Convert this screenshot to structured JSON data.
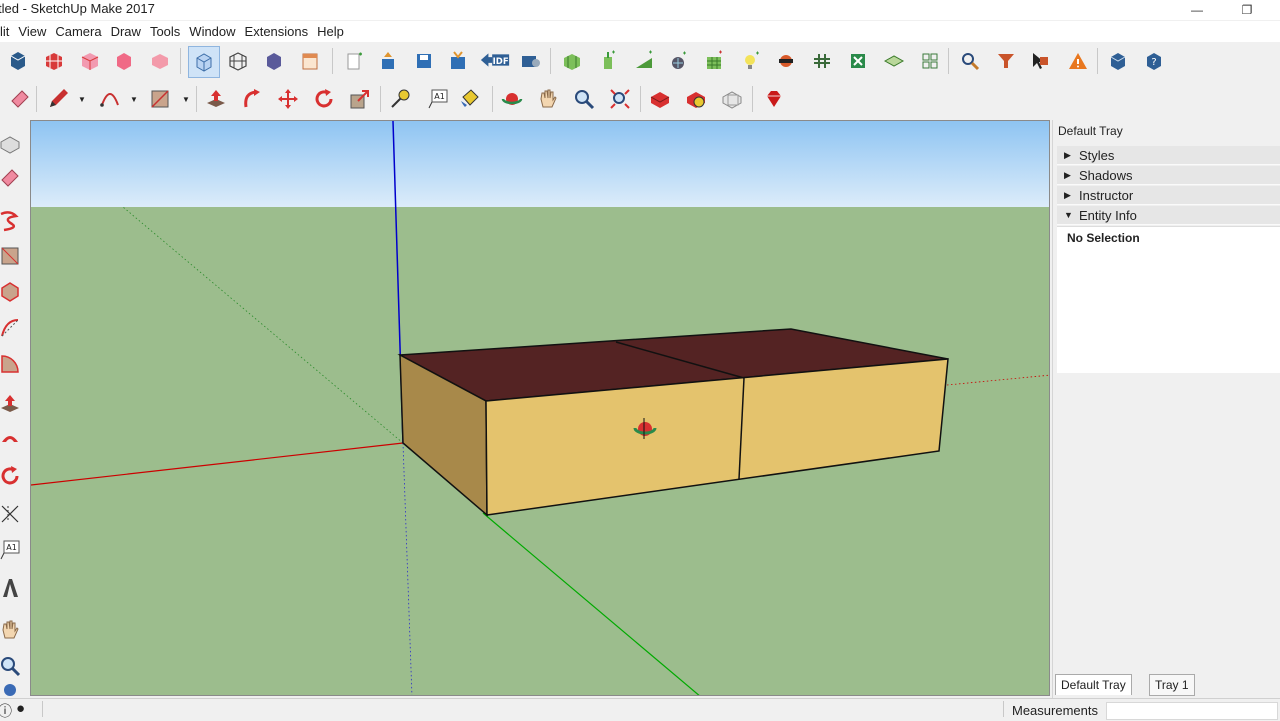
{
  "window": {
    "title": "tled - SketchUp Make 2017",
    "minimize_glyph": "—",
    "restore_glyph": "❐"
  },
  "menu": [
    "lit",
    "View",
    "Camera",
    "Draw",
    "Tools",
    "Window",
    "Extensions",
    "Help"
  ],
  "toolbar_top_icons": [
    "model-info-icon",
    "components-icon",
    "x-ray-icon",
    "back-edges-icon",
    "wireframe-icon",
    "iso-view-icon",
    "warehouse-icon",
    "extension-warehouse-icon",
    "layout-icon",
    "new-icon",
    "export-icon",
    "save-icon",
    "import-idf-icon",
    "export-idf-icon",
    "idf-settings-icon",
    "new-zone-icon",
    "new-space-icon",
    "new-surface-icon",
    "new-subsurface-icon",
    "new-shading-icon",
    "daylighting-icon",
    "illuminance-icon",
    "glare-icon",
    "construction-icon",
    "render-icon",
    "layer-icon",
    "info-tool-icon",
    "search-icon",
    "filter-icon",
    "cursor-tool-icon",
    "warning-icon",
    "run-simulation-icon",
    "help-icon"
  ],
  "toolbar_second_icons": [
    "eraser-icon",
    "pencil-icon",
    "arc-icon",
    "shape-icon",
    "push-pull-icon",
    "follow-me-icon",
    "move-icon",
    "rotate-icon",
    "scale-icon",
    "tape-measure-icon",
    "text-label-icon",
    "paint-bucket-icon",
    "orbit-icon",
    "pan-icon",
    "zoom-icon",
    "zoom-extents-icon",
    "materials-icon",
    "styles-icon",
    "section-icon",
    "ruby-icon"
  ],
  "left_toolbar_icons": [
    "select-icon",
    "eraser-icon",
    "freehand-icon",
    "rectangle-icon",
    "polygon-icon",
    "arc-icon",
    "pie-icon",
    "push-pull-icon",
    "follow-me-icon",
    "offset-icon",
    "axes-icon",
    "text-icon",
    "3d-text-icon",
    "pan-icon",
    "zoom-icon",
    "orbit-icon"
  ],
  "text_label_glyph": "A1",
  "tray": {
    "title": "Default Tray",
    "sections": [
      {
        "label": "Styles",
        "expanded": false
      },
      {
        "label": "Shadows",
        "expanded": false
      },
      {
        "label": "Instructor",
        "expanded": false
      },
      {
        "label": "Entity Info",
        "expanded": true
      }
    ],
    "collapsed_glyph": "▶",
    "expanded_glyph": "▼",
    "entity_info": "No Selection",
    "tabs": [
      "Default Tray",
      "Tray 1"
    ],
    "active_tab": 0
  },
  "status": {
    "measurements_label": "Measurements",
    "measurements_value": ""
  },
  "colors": {
    "sky": "#8ec4f2",
    "ground": "#9cbd8d",
    "box_top": "#542323",
    "box_front": "#e4c36d",
    "box_side": "#a8894a",
    "axis_red": "#cc0000",
    "axis_green": "#00aa00",
    "axis_blue": "#0000cc"
  }
}
